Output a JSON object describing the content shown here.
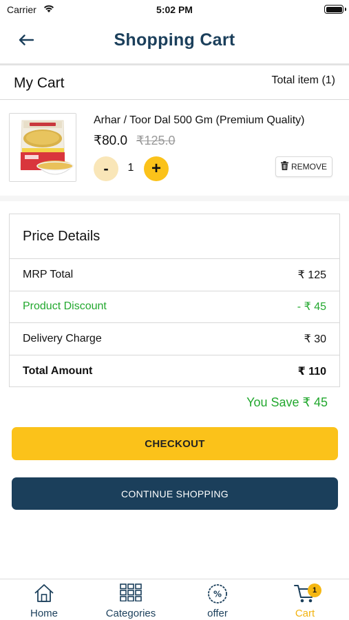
{
  "status_bar": {
    "carrier": "Carrier",
    "time": "5:02 PM"
  },
  "header": {
    "title": "Shopping Cart",
    "back_icon": "arrow-left-icon"
  },
  "cart": {
    "title": "My Cart",
    "total_items": "Total item (1)",
    "items": [
      {
        "name": "Arhar / Toor Dal 500 Gm (Premium Quality)",
        "price": "₹80.0",
        "mrp": "₹125.0",
        "quantity": "1",
        "minus_label": "-",
        "plus_label": "+",
        "remove_label": "REMOVE",
        "image_icon": "dal-packet-image"
      }
    ]
  },
  "price_details": {
    "title": "Price Details",
    "rows": [
      {
        "label": "MRP Total",
        "value": "₹ 125"
      },
      {
        "label": "Product Discount",
        "value": "- ₹ 45"
      },
      {
        "label": "Delivery Charge",
        "value": "₹ 30"
      },
      {
        "label": "Total Amount",
        "value": "₹ 110"
      }
    ]
  },
  "you_save": "You Save ₹ 45",
  "buttons": {
    "checkout": "CHECKOUT",
    "continue": "CONTINUE SHOPPING"
  },
  "tabbar": {
    "tabs": [
      {
        "label": "Home",
        "icon": "home-icon"
      },
      {
        "label": "Categories",
        "icon": "grid-icon"
      },
      {
        "label": "offer",
        "icon": "percent-icon"
      },
      {
        "label": "Cart",
        "icon": "cart-icon"
      }
    ],
    "active": "Cart",
    "cart_badge": "1"
  },
  "colors": {
    "primary": "#1b3f5b",
    "accent": "#fbc21a",
    "success": "#22a82e",
    "muted": "#9a9a9a"
  }
}
